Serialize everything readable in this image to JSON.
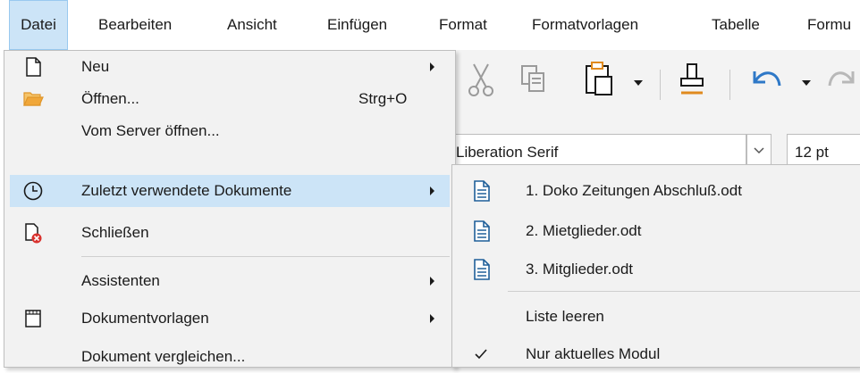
{
  "menubar": {
    "items": [
      "Datei",
      "Bearbeiten",
      "Ansicht",
      "Einfügen",
      "Format",
      "Formatvorlagen",
      "Tabelle",
      "Formu"
    ]
  },
  "toolbar": {
    "font_name": "Liberation Serif",
    "font_size": "12 pt"
  },
  "file_menu": {
    "items": [
      {
        "label": "Neu",
        "icon": "new-document-icon"
      },
      {
        "label": "Öffnen...",
        "shortcut": "Strg+O",
        "icon": "folder-open-icon"
      },
      {
        "label": "Vom Server öffnen..."
      },
      {
        "label": "Zuletzt verwendete Dokumente",
        "icon": "clock-icon"
      },
      {
        "label": "Schließen",
        "icon": "close-document-icon"
      },
      {
        "label": "Assistenten"
      },
      {
        "label": "Dokumentvorlagen",
        "icon": "template-icon"
      },
      {
        "label": "Dokument vergleichen..."
      }
    ]
  },
  "recent_submenu": {
    "items": [
      {
        "label": "1. Doko Zeitungen Abschluß.odt",
        "icon": "text-document-icon"
      },
      {
        "label": "2. Mietglieder.odt",
        "icon": "text-document-icon"
      },
      {
        "label": "3. Mitglieder.odt",
        "icon": "text-document-icon"
      },
      {
        "label": "Liste leeren"
      },
      {
        "label": "Nur aktuelles Modul",
        "checked": true
      }
    ]
  },
  "colors": {
    "highlight": "#cce4f7",
    "menu_bg": "#f2f2f2",
    "doc_icon": "#1f5f99",
    "folder": "#f0a73a",
    "close_badge": "#d9322e"
  }
}
